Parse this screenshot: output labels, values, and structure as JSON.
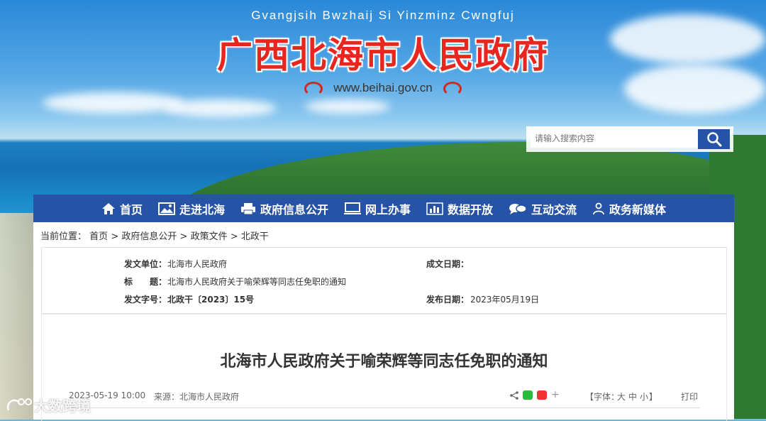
{
  "header": {
    "pinyin": "Gvangjsih Bwzhaij Si Yinzminz Cwngfuj",
    "title": "广西北海市人民政府",
    "url": "www.beihai.gov.cn"
  },
  "search": {
    "placeholder": "请输入搜索内容",
    "icon": "search-icon"
  },
  "nav": [
    {
      "label": "首页",
      "icon": "home-icon"
    },
    {
      "label": "走进北海",
      "icon": "picture-icon"
    },
    {
      "label": "政府信息公开",
      "icon": "printer-icon"
    },
    {
      "label": "网上办事",
      "icon": "monitor-icon"
    },
    {
      "label": "数据开放",
      "icon": "bar-chart-icon"
    },
    {
      "label": "互动交流",
      "icon": "chat-icon"
    },
    {
      "label": "政务新媒体",
      "icon": "user-icon"
    }
  ],
  "breadcrumb": {
    "prefix": "当前位置：",
    "items": [
      "首页",
      "政府信息公开",
      "政策文件",
      "北政干"
    ],
    "separator": ">"
  },
  "meta": {
    "issuer_label": "发文单位：",
    "issuer": "北海市人民政府",
    "date_written_label": "成文日期：",
    "date_written": "",
    "subject_label": "标　　题：",
    "subject": "北海市人民政府关于喻荣辉等同志任免职的通知",
    "doc_no_label": "发文字号：",
    "doc_no": "北政干〔2023〕15号",
    "publish_label": "发布日期：",
    "publish_date": "2023年05月19日"
  },
  "article": {
    "title": "北海市人民政府关于喻荣辉等同志任免职的通知",
    "datetime": "2023-05-19 10:00",
    "source_label": "来源：",
    "source": "北海市人民政府",
    "font_label": "【字体：",
    "font_large": "大",
    "font_medium": "中",
    "font_small": "小",
    "font_close": "】",
    "print": "打印"
  },
  "watermark": {
    "text": "大数跨境"
  },
  "colors": {
    "nav_bg": "#2653a6",
    "title_red": "#e8251f"
  }
}
